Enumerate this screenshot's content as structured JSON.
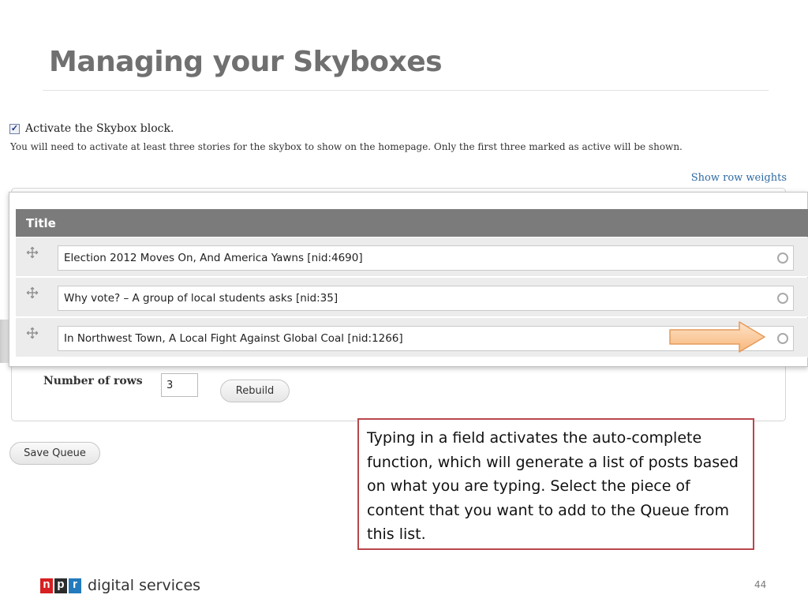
{
  "slide": {
    "title": "Managing your Skyboxes",
    "page_number": "44"
  },
  "form": {
    "activate_label": "Activate the Skybox block.",
    "activate_checked": true,
    "help_text": "You will need to activate at least three stories for the skybox to show on the homepage. Only the first three marked as active will be shown.",
    "show_row_weights": "Show row weights",
    "table": {
      "header": "Title",
      "rows": [
        {
          "value": "Election 2012 Moves On, And America Yawns [nid:4690]"
        },
        {
          "value": "Why vote? – A group of local students asks [nid:35]"
        },
        {
          "value": "In Northwest Town, A Local Fight Against Global Coal [nid:1266]"
        }
      ]
    },
    "number_of_rows_label": "Number of rows",
    "number_of_rows_value": "3",
    "rebuild_label": "Rebuild",
    "save_label": "Save Queue"
  },
  "callout": {
    "text": "Typing in a field activates the auto-complete function, which will generate a list of posts based on what you are typing. Select the piece of content that you want to add to the Queue from this list."
  },
  "footer": {
    "logo_n": "n",
    "logo_p": "p",
    "logo_r": "r",
    "logo_text": "digital services"
  },
  "colors": {
    "title_grey": "#707070",
    "table_header": "#7b7b7b",
    "callout_border": "#b8474b",
    "arrow_fill": "#fbc293",
    "arrow_stroke": "#e59a5a",
    "link_blue": "#2f6aa3"
  }
}
